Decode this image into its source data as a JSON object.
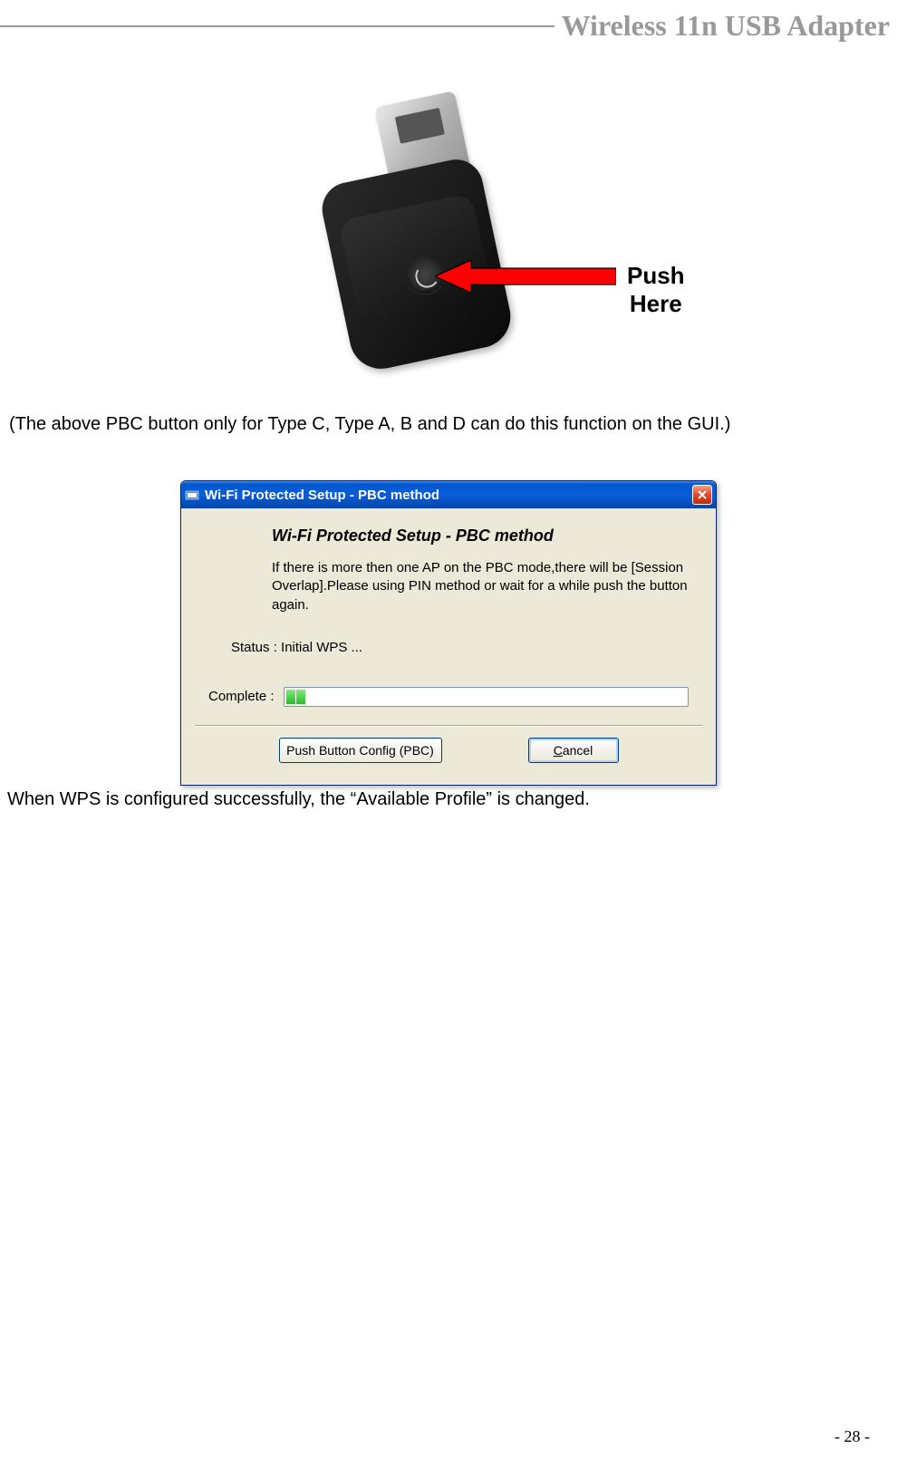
{
  "header": {
    "title": "Wireless 11n USB Adapter"
  },
  "figure1": {
    "annotation": "Push Here"
  },
  "caption1": "(The above PBC button only for Type C, Type A, B and D can do this function on the GUI.)",
  "dialog": {
    "title": "Wi-Fi Protected Setup - PBC method",
    "heading": "Wi-Fi Protected Setup - PBC method",
    "description": "If there is more then one AP on the PBC mode,there will be [Session Overlap].Please using PIN method or wait for a while push the button again.",
    "status_label": "Status :",
    "status_value": "Initial WPS ...",
    "complete_label": "Complete :",
    "progress_segments": 2,
    "buttons": {
      "pbc": "Push Button Config (PBC)",
      "cancel_prefix": "C",
      "cancel_rest": "ancel"
    }
  },
  "footer_text": "When WPS is configured successfully, the “Available Profile” is changed.",
  "page_number": "- 28 -"
}
